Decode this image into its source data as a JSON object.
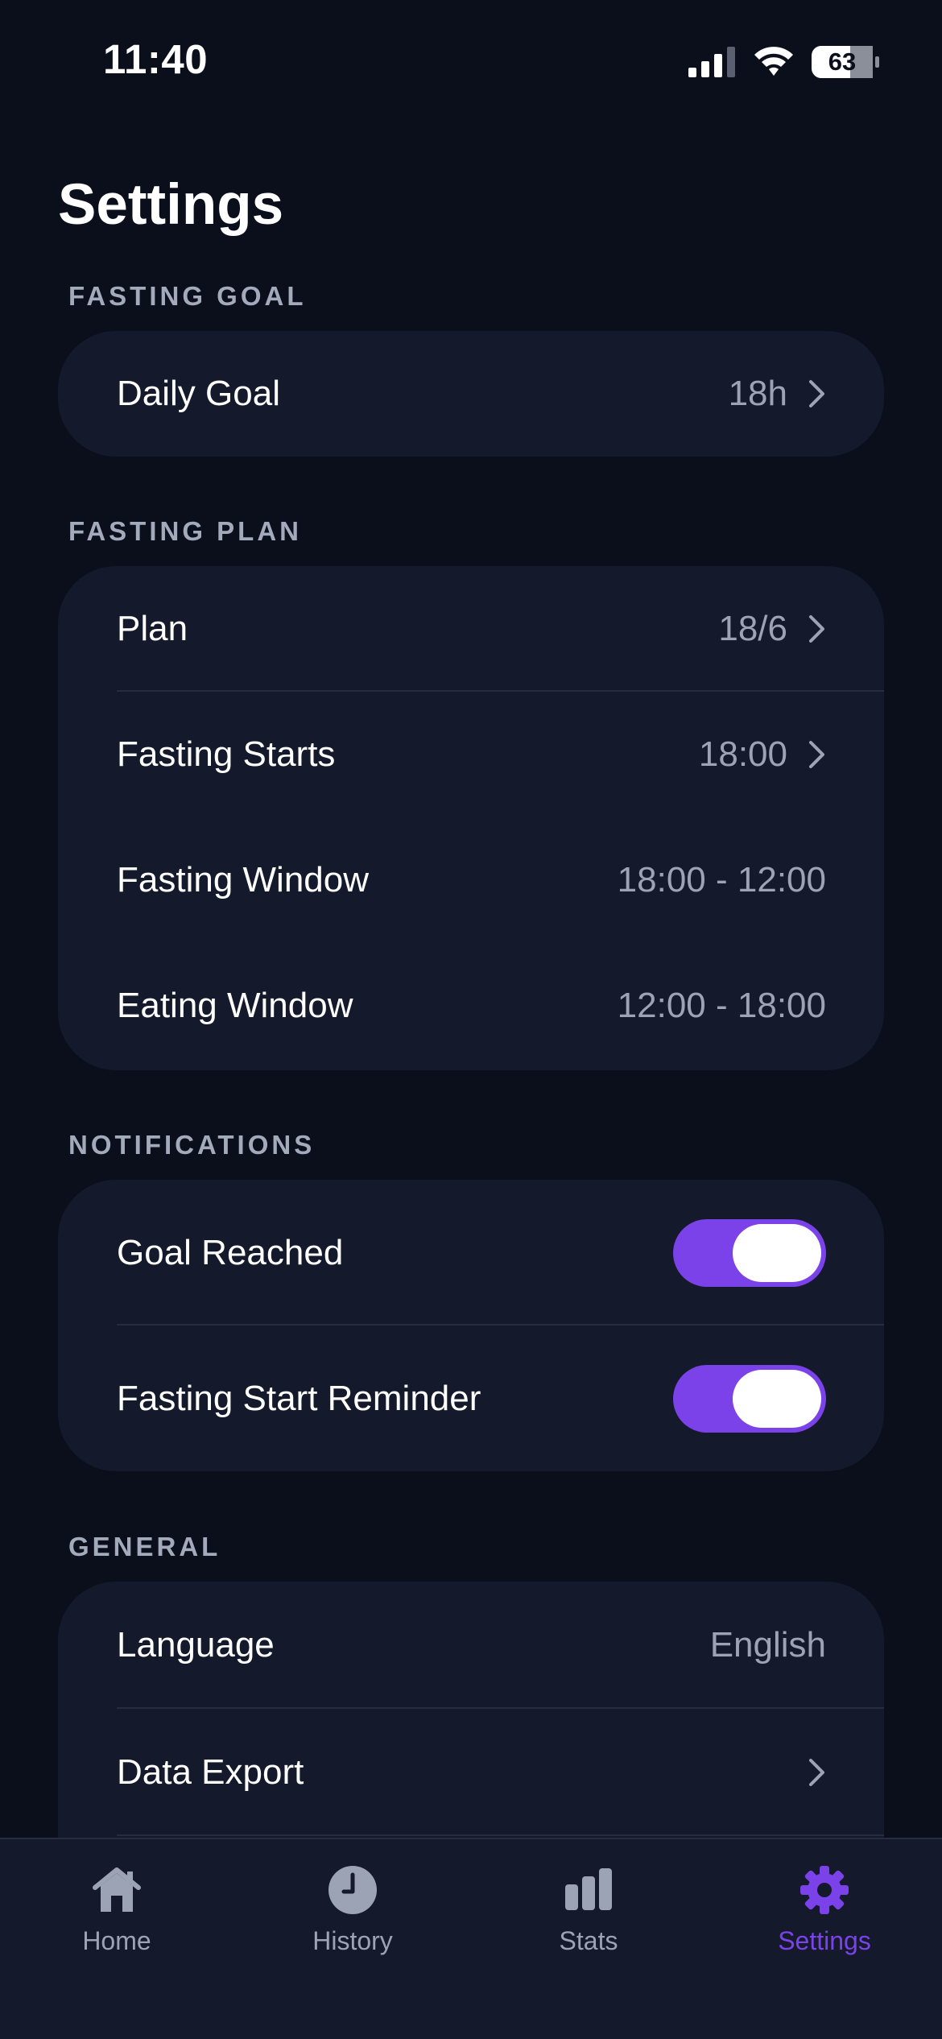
{
  "status_bar": {
    "time": "11:40",
    "battery": "63"
  },
  "page": {
    "title": "Settings"
  },
  "sections": {
    "fasting_goal": {
      "header": "FASTING GOAL",
      "rows": [
        {
          "label": "Daily Goal",
          "value": "18h"
        }
      ]
    },
    "fasting_plan": {
      "header": "FASTING PLAN",
      "rows": [
        {
          "label": "Plan",
          "value": "18/6"
        },
        {
          "label": "Fasting Starts",
          "value": "18:00"
        },
        {
          "label": "Fasting Window",
          "value": "18:00 - 12:00"
        },
        {
          "label": "Eating Window",
          "value": "12:00 - 18:00"
        }
      ]
    },
    "notifications": {
      "header": "NOTIFICATIONS",
      "rows": [
        {
          "label": "Goal Reached",
          "enabled": true
        },
        {
          "label": "Fasting Start Reminder",
          "enabled": true
        }
      ]
    },
    "general": {
      "header": "GENERAL",
      "rows": [
        {
          "label": "Language",
          "value": "English"
        },
        {
          "label": "Data Export",
          "value": ""
        }
      ]
    }
  },
  "tab_bar": {
    "tabs": [
      {
        "label": "Home",
        "icon": "home-icon"
      },
      {
        "label": "History",
        "icon": "clock-icon"
      },
      {
        "label": "Stats",
        "icon": "bar-chart-icon"
      },
      {
        "label": "Settings",
        "icon": "gear-icon"
      }
    ],
    "active": "Settings"
  },
  "colors": {
    "background": "#0b0f1c",
    "card": "#141a2b",
    "accent": "#7a42e8",
    "secondary_text": "#9ba3b4"
  }
}
